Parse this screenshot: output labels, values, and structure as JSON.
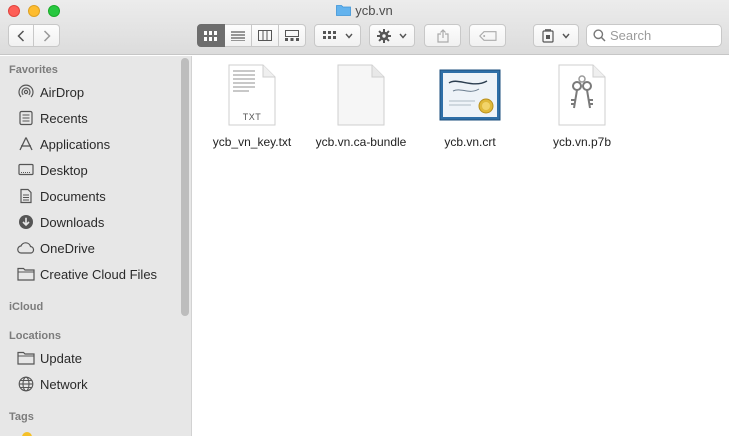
{
  "window": {
    "title": "ycb.vn"
  },
  "toolbar": {
    "search": {
      "placeholder": "Search",
      "value": ""
    }
  },
  "sidebar": {
    "sections": {
      "favorites": "Favorites",
      "icloud": "iCloud",
      "locations": "Locations",
      "tags": "Tags"
    },
    "favorites": [
      {
        "label": "AirDrop",
        "icon": "airdrop-icon"
      },
      {
        "label": "Recents",
        "icon": "clock-icon"
      },
      {
        "label": "Applications",
        "icon": "applications-icon"
      },
      {
        "label": "Desktop",
        "icon": "desktop-icon"
      },
      {
        "label": "Documents",
        "icon": "document-icon"
      },
      {
        "label": "Downloads",
        "icon": "download-icon"
      },
      {
        "label": "OneDrive",
        "icon": "cloud-icon"
      },
      {
        "label": "Creative Cloud Files",
        "icon": "folder-icon"
      }
    ],
    "locations": [
      {
        "label": "Update",
        "icon": "folder-icon"
      },
      {
        "label": "Network",
        "icon": "globe-icon"
      }
    ]
  },
  "files": [
    {
      "name": "ycb_vn_key.txt",
      "icon": "text-file-icon",
      "badge": "TXT"
    },
    {
      "name": "ycb.vn.ca-bundle",
      "icon": "blank-file-icon"
    },
    {
      "name": "ycb.vn.crt",
      "icon": "certificate-icon"
    },
    {
      "name": "ycb.vn.p7b",
      "icon": "keychain-file-icon"
    }
  ]
}
